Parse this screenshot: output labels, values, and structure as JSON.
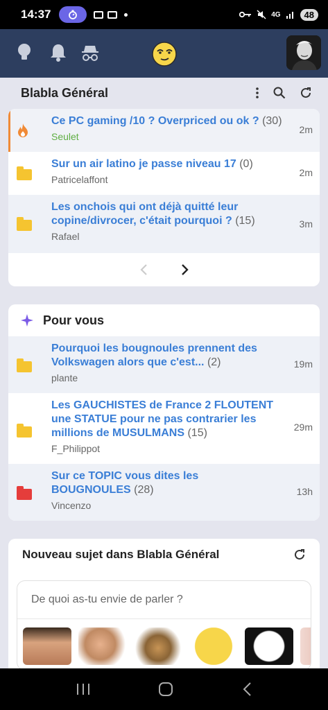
{
  "status_bar": {
    "time": "14:37",
    "net_label": "4G",
    "battery": "48"
  },
  "colors": {
    "header": "#2d3e5f",
    "link": "#3a7ed6",
    "hot_accent": "#f08a36",
    "folder": "#f5c430",
    "folder_red": "#e53d3b",
    "sparkle": "#7b5be6"
  },
  "forum": {
    "title": "Blabla Général",
    "topics": [
      {
        "title": "Ce PC gaming /10 ? Overpriced ou ok ?",
        "count": "(30)",
        "author": "Seulet",
        "time": "2m",
        "icon": "fire-icon"
      },
      {
        "title": "Sur un air latino je passe niveau 17",
        "count": "(0)",
        "author": "Patricelaffont",
        "time": "2m",
        "icon": "folder-icon"
      },
      {
        "title": "Les onchois qui ont déjà quitté leur copine/divrocer, c'était pourquoi ?",
        "count": "(15)",
        "author": "Rafael",
        "time": "3m",
        "icon": "folder-icon"
      }
    ]
  },
  "for_you": {
    "title": "Pour vous",
    "topics": [
      {
        "title": "Pourquoi les bougnoules prennent des Volkswagen alors que c'est...",
        "count": "(2)",
        "author": "plante",
        "time": "19m",
        "icon": "folder-icon"
      },
      {
        "title": "Les GAUCHISTES de France 2 FLOUTENT une STATUE pour ne pas contrarier les millions de MUSULMANS",
        "count": "(15)",
        "author": "F_Philippot",
        "time": "29m",
        "icon": "folder-icon"
      },
      {
        "title": "Sur ce TOPIC vous dites les BOUGNOULES",
        "count": "(28)",
        "author": "Vincenzo",
        "time": "13h",
        "icon": "folder-red-icon"
      }
    ]
  },
  "new_topic": {
    "title": "Nouveau sujet dans Blabla Général",
    "placeholder": "De quoi as-tu envie de parler ?"
  }
}
